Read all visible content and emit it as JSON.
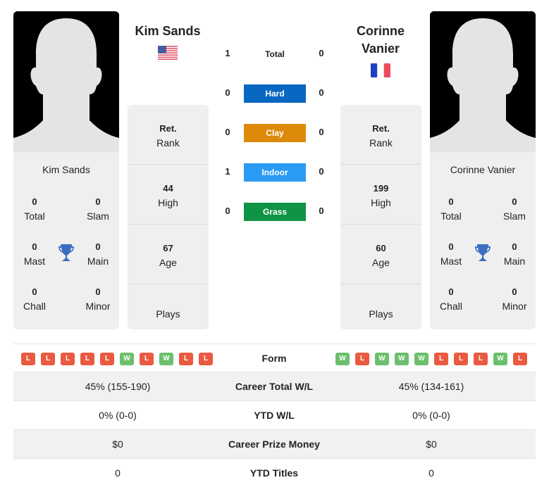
{
  "player1": {
    "name": "Kim Sands",
    "country_flag": "usa-flag",
    "titles": {
      "total": {
        "value": "0",
        "label": "Total"
      },
      "slam": {
        "value": "0",
        "label": "Slam"
      },
      "mast": {
        "value": "0",
        "label": "Mast"
      },
      "main": {
        "value": "0",
        "label": "Main"
      },
      "chall": {
        "value": "0",
        "label": "Chall"
      },
      "minor": {
        "value": "0",
        "label": "Minor"
      }
    },
    "stats": {
      "rank": {
        "value": "Ret.",
        "label": "Rank"
      },
      "high": {
        "value": "44",
        "label": "High"
      },
      "age": {
        "value": "67",
        "label": "Age"
      },
      "plays": {
        "value": "",
        "label": "Plays"
      }
    },
    "form": [
      "L",
      "L",
      "L",
      "L",
      "L",
      "W",
      "L",
      "W",
      "L",
      "L"
    ]
  },
  "player2": {
    "name": "Corinne Vanier",
    "name_line1": "Corinne",
    "name_line2": "Vanier",
    "country_flag": "france-flag",
    "titles": {
      "total": {
        "value": "0",
        "label": "Total"
      },
      "slam": {
        "value": "0",
        "label": "Slam"
      },
      "mast": {
        "value": "0",
        "label": "Mast"
      },
      "main": {
        "value": "0",
        "label": "Main"
      },
      "chall": {
        "value": "0",
        "label": "Chall"
      },
      "minor": {
        "value": "0",
        "label": "Minor"
      }
    },
    "stats": {
      "rank": {
        "value": "Ret.",
        "label": "Rank"
      },
      "high": {
        "value": "199",
        "label": "High"
      },
      "age": {
        "value": "60",
        "label": "Age"
      },
      "plays": {
        "value": "",
        "label": "Plays"
      }
    },
    "form": [
      "W",
      "L",
      "W",
      "W",
      "W",
      "L",
      "L",
      "L",
      "W",
      "L"
    ]
  },
  "h2h": [
    {
      "label": "Total",
      "p1": "1",
      "p2": "0",
      "color": ""
    },
    {
      "label": "Hard",
      "p1": "0",
      "p2": "0",
      "color": "#0867c1"
    },
    {
      "label": "Clay",
      "p1": "0",
      "p2": "0",
      "color": "#dd8a0b"
    },
    {
      "label": "Indoor",
      "p1": "1",
      "p2": "0",
      "color": "#2b9af3"
    },
    {
      "label": "Grass",
      "p1": "0",
      "p2": "0",
      "color": "#0f9445"
    }
  ],
  "form_label": "Form",
  "comparison": [
    {
      "label": "Career Total W/L",
      "p1": "45% (155-190)",
      "p2": "45% (134-161)"
    },
    {
      "label": "YTD W/L",
      "p1": "0% (0-0)",
      "p2": "0% (0-0)"
    },
    {
      "label": "Career Prize Money",
      "p1": "$0",
      "p2": "$0"
    },
    {
      "label": "YTD Titles",
      "p1": "0",
      "p2": "0"
    }
  ],
  "colors": {
    "win": "#6cbf6c",
    "loss": "#ea5a40",
    "trophy": "#3a6fc0",
    "card_bg": "#efefef"
  }
}
